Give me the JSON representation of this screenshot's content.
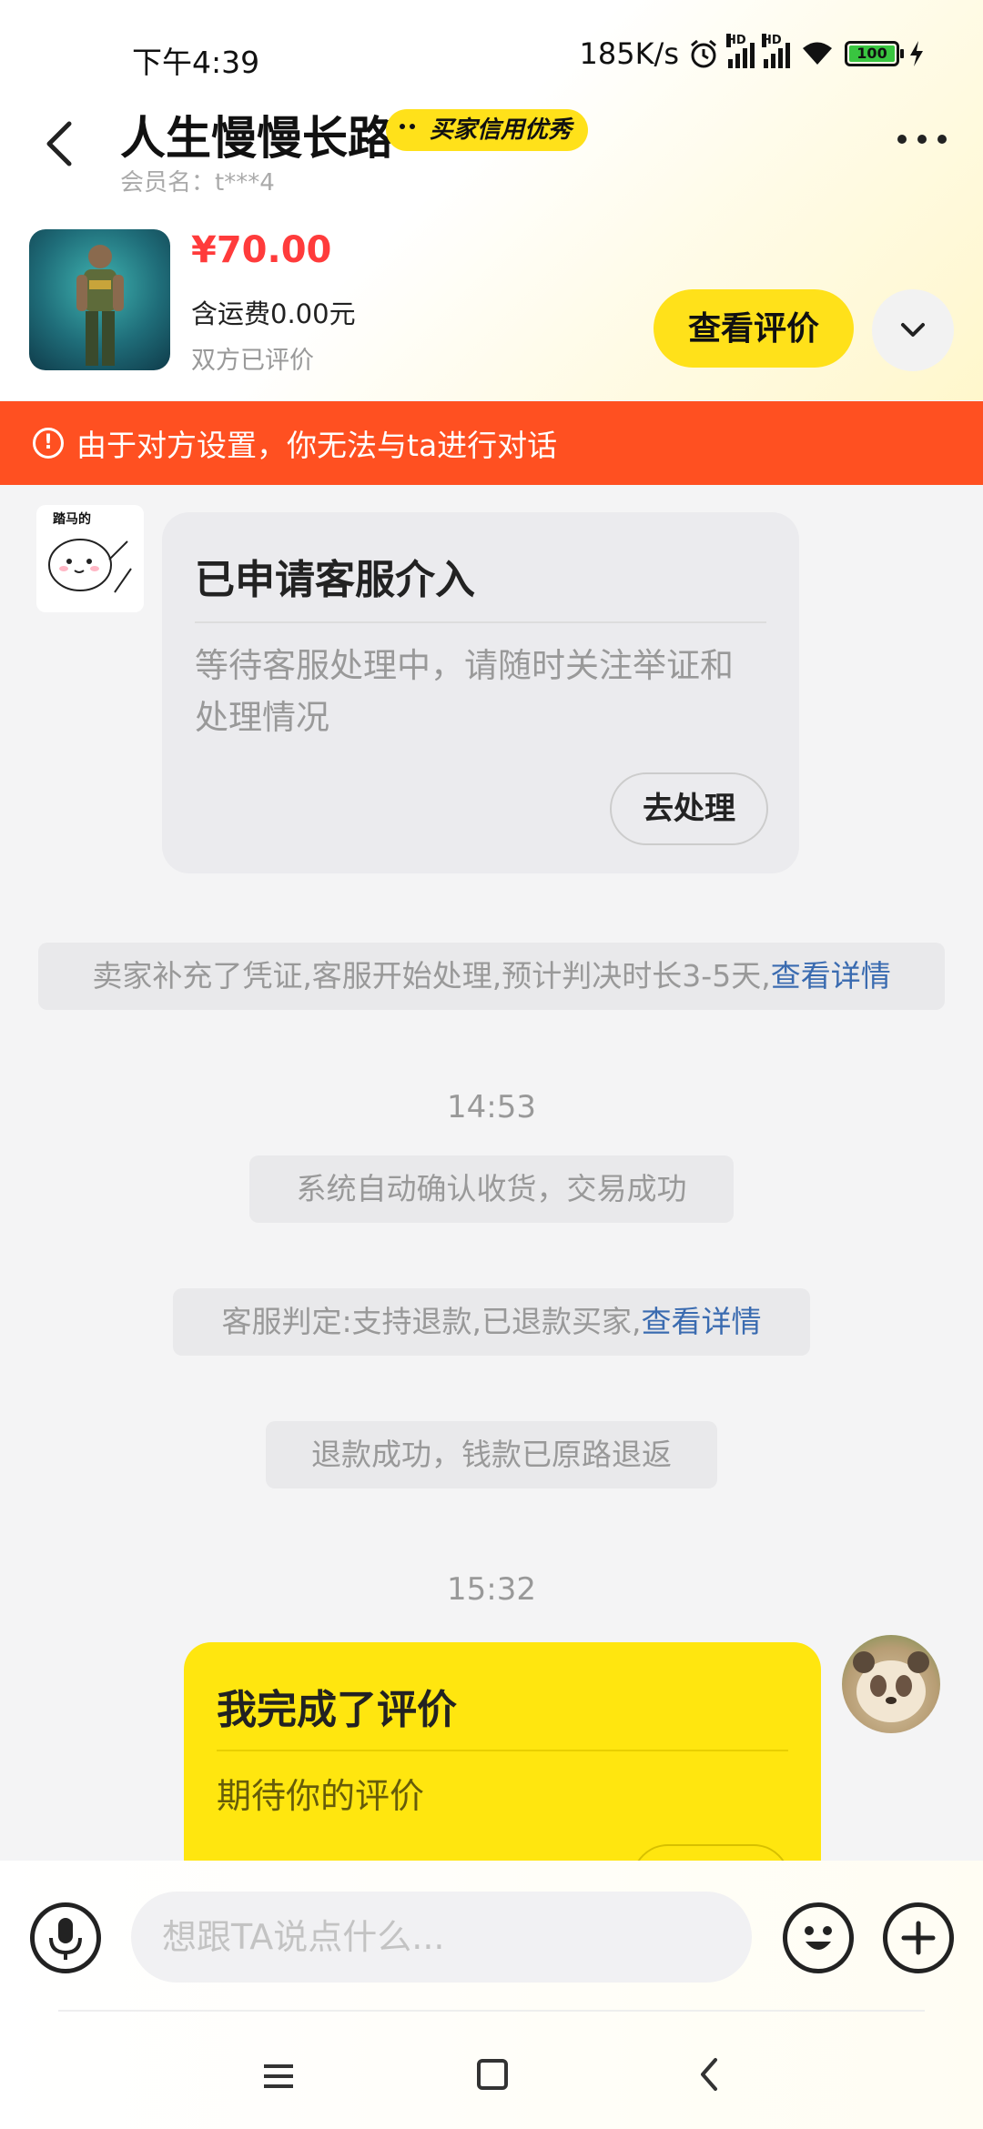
{
  "status_bar": {
    "time": "下午4:39",
    "net_speed": "185K/s",
    "sim1": "HD",
    "sim2": "HD",
    "battery": "100"
  },
  "header": {
    "title": "人生慢慢长路",
    "badge": "买家信用优秀",
    "member": "会员名：t***4"
  },
  "product": {
    "price": "¥70.00",
    "shipping": "含运费0.00元",
    "evaluation_status": "双方已评价",
    "view_review_label": "查看评价"
  },
  "banner": {
    "text": "由于对方设置，你无法与ta进行对话",
    "icon": "!",
    "color": "#ff5021"
  },
  "chat": {
    "service_card": {
      "title": "已申请客服介入",
      "desc": "等待客服处理中，请随时关注举证和处理情况",
      "button": "去处理"
    },
    "system_msg_1": {
      "text": "卖家补充了凭证,客服开始处理,预计判决时长3-5天,",
      "link": "查看详情"
    },
    "time_1": "14:53",
    "system_msg_2": "系统自动确认收货，交易成功",
    "system_msg_3": {
      "text": "客服判定:支持退款,已退款买家,",
      "link": "查看详情"
    },
    "system_msg_4": "退款成功，钱款已原路退返",
    "time_2": "15:32",
    "review_card": {
      "title": "我完成了评价",
      "desc": "期待你的评价"
    }
  },
  "input_bar": {
    "placeholder": "想跟TA说点什么..."
  },
  "colors": {
    "accent_yellow": "#ffe11a",
    "price_red": "#ff3b3b",
    "link_blue": "#3a6bb0"
  }
}
